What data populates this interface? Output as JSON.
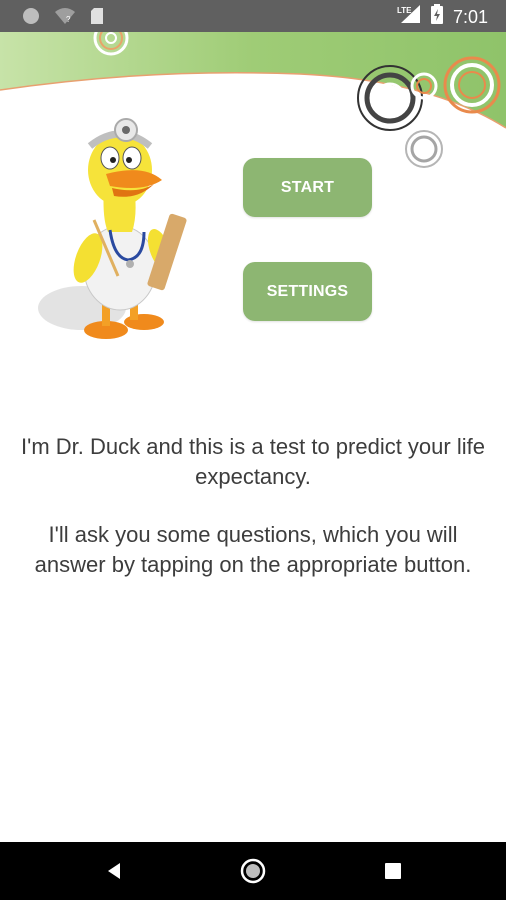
{
  "status_bar": {
    "time": "7:01",
    "network_label": "LTE",
    "icons": [
      "notification-circle-icon",
      "wifi-question-icon",
      "sd-card-icon",
      "lte-signal-icon",
      "battery-charging-icon"
    ]
  },
  "menu": {
    "start_label": "START",
    "settings_label": "SETTINGS"
  },
  "intro": {
    "paragraph_1": "I'm Dr. Duck and this is a test to predict your life expectancy.",
    "paragraph_2": "I'll ask you some questions, which you will answer by tapping on the appropriate button."
  },
  "nav_bar": {
    "icons": [
      "back-icon",
      "home-icon",
      "recents-icon"
    ]
  },
  "colors": {
    "status_bar": "#606060",
    "button_green": "#8db672",
    "header_green": "#8fc36a",
    "text": "#3d3d3d",
    "nav_bar": "#000000"
  }
}
